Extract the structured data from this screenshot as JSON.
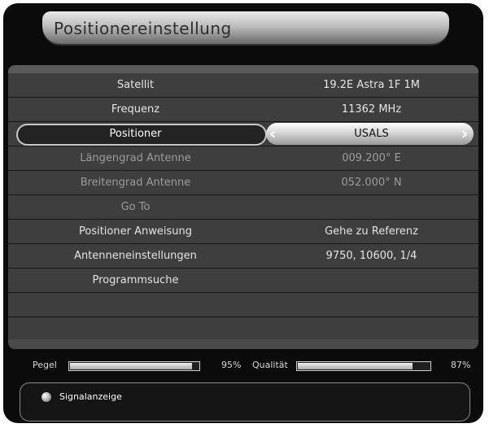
{
  "title": "Positionereinstellung",
  "rows": [
    {
      "label": "Satellit",
      "value": "19.2E Astra 1F 1M"
    },
    {
      "label": "Frequenz",
      "value": "11362 MHz"
    },
    {
      "label": "Positioner",
      "value": "USALS"
    },
    {
      "label": "Längengrad Antenne",
      "value": "009.200° E"
    },
    {
      "label": "Breitengrad Antenne",
      "value": "052.000° N"
    },
    {
      "label": "Go To",
      "value": ""
    },
    {
      "label": "Positioner Anweisung",
      "value": "Gehe zu Referenz"
    },
    {
      "label": "Antenneneinstellungen",
      "value": "9750, 10600, 1/4"
    },
    {
      "label": "Programmsuche",
      "value": ""
    },
    {
      "label": "",
      "value": ""
    },
    {
      "label": "",
      "value": ""
    }
  ],
  "selected_index": 2,
  "signal": {
    "pegel_label": "Pegel",
    "pegel_value": 95,
    "pegel_text": "95%",
    "qualitat_label": "Qualität",
    "qualitat_value": 87,
    "qualitat_text": "87%"
  },
  "info": {
    "label": "Signalanzeige"
  },
  "icons": {
    "left": "chevron-left-icon",
    "right": "chevron-right-icon",
    "radio": "radio-dot-icon"
  }
}
